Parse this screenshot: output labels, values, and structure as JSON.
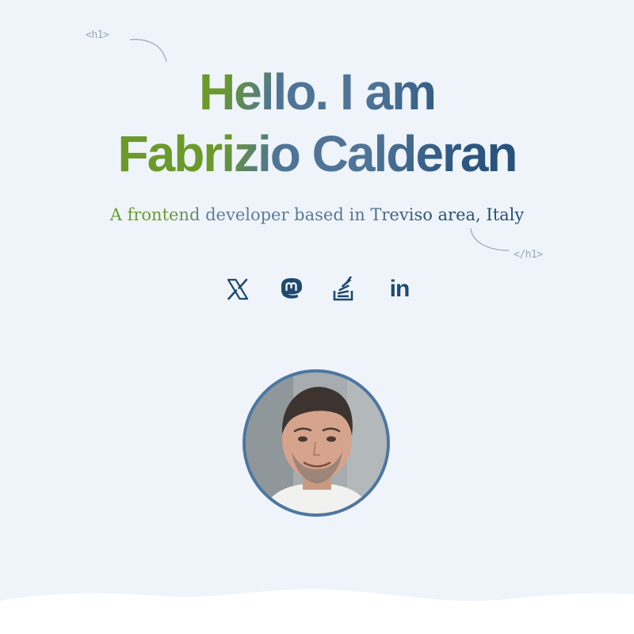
{
  "code_tags": {
    "open": "<h1>",
    "close": "</h1>"
  },
  "hero": {
    "heading_line1": "Hello. I am",
    "heading_line2": "Fabrizio Calderan",
    "subtitle": "A frontend developer based in Treviso area, Italy"
  },
  "socials": [
    {
      "name": "X",
      "icon": "x-icon"
    },
    {
      "name": "Mastodon",
      "icon": "mastodon-icon"
    },
    {
      "name": "Stack Overflow",
      "icon": "stackoverflow-icon"
    },
    {
      "name": "LinkedIn",
      "icon": "linkedin-icon",
      "glyph": "in"
    }
  ],
  "colors": {
    "background": "#eff4fb",
    "accent_green": "#6b9a2b",
    "accent_blue": "#1f4a6e",
    "avatar_border": "#4d76a1"
  }
}
